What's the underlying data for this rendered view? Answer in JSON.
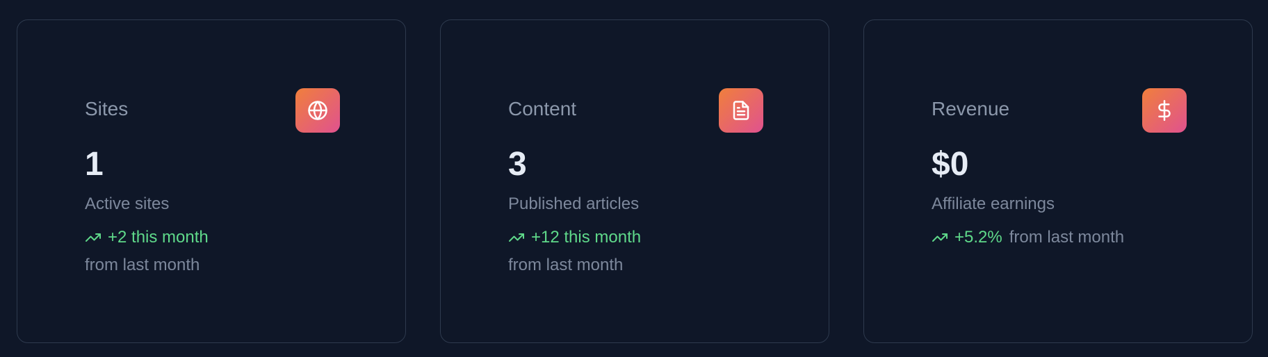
{
  "colors": {
    "background": "#0f1728",
    "card_border": "#2e3a4e",
    "title_text": "#8c98ab",
    "value_text": "#e6ecf5",
    "muted_text": "#7d889c",
    "trend_positive": "#5fd98a",
    "icon_gradient_start": "#f07f3c",
    "icon_gradient_end": "#e0528f"
  },
  "cards": [
    {
      "title": "Sites",
      "icon": "globe-icon",
      "value": "1",
      "description": "Active sites",
      "trend_icon": "trending-up-icon",
      "trend_value": "+2 this month",
      "trend_note": "from last month"
    },
    {
      "title": "Content",
      "icon": "file-text-icon",
      "value": "3",
      "description": "Published articles",
      "trend_icon": "trending-up-icon",
      "trend_value": "+12 this month",
      "trend_note": "from last month"
    },
    {
      "title": "Revenue",
      "icon": "dollar-sign-icon",
      "value": "$0",
      "description": "Affiliate earnings",
      "trend_icon": "trending-up-icon",
      "trend_value": "+5.2%",
      "trend_note": "from last month"
    }
  ]
}
